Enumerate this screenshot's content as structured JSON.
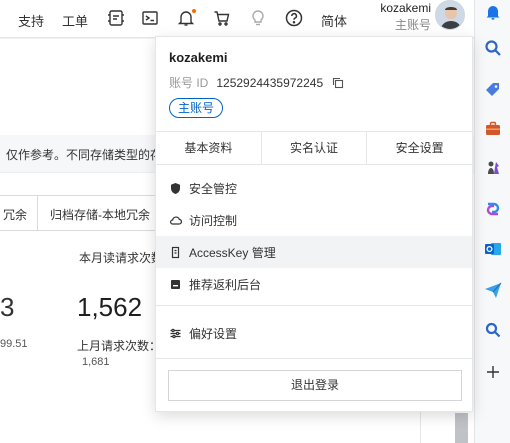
{
  "topbar": {
    "support": "支持",
    "ticket": "工单",
    "language": "简体",
    "username": "kozakemi",
    "role": "主账号",
    "icons": [
      "icp-icon",
      "terminal-icon",
      "bell-icon",
      "cart-icon",
      "bulb-icon",
      "help-icon"
    ],
    "notification_dot_color": "#ff6a00"
  },
  "background": {
    "notice": "仅作参考。不同存储类型的存",
    "tabs": [
      "冗余",
      "归档存储-本地冗余"
    ],
    "stat_label": "本月读请求次数",
    "stat_value": "1,562",
    "stat_prev_label": "上月请求次数：",
    "stat_prev_value": "1,681",
    "left_big": "3",
    "left_small": "99.51"
  },
  "panel": {
    "name": "kozakemi",
    "id_label": "账号 ID",
    "id_value": "1252924435972245",
    "badge": "主账号",
    "tabs": [
      "基本资料",
      "实名认证",
      "安全设置"
    ],
    "menu": [
      {
        "label": "安全管控",
        "icon": "shield-icon"
      },
      {
        "label": "访问控制",
        "icon": "cloud-icon"
      },
      {
        "label": "AccessKey 管理",
        "icon": "key-icon"
      },
      {
        "label": "推荐返利后台",
        "icon": "gift-icon"
      }
    ],
    "preference": "偏好设置",
    "logout": "退出登录"
  },
  "edgebar": {
    "icons": [
      "bell-icon",
      "search-icon",
      "tag-icon",
      "briefcase-icon",
      "chess-icon",
      "copilot-icon",
      "outlook-icon",
      "send-icon",
      "search-small-icon",
      "add-icon"
    ]
  },
  "colors": {
    "accent": "#0064c8",
    "edge_blue": "#1a73e8"
  }
}
